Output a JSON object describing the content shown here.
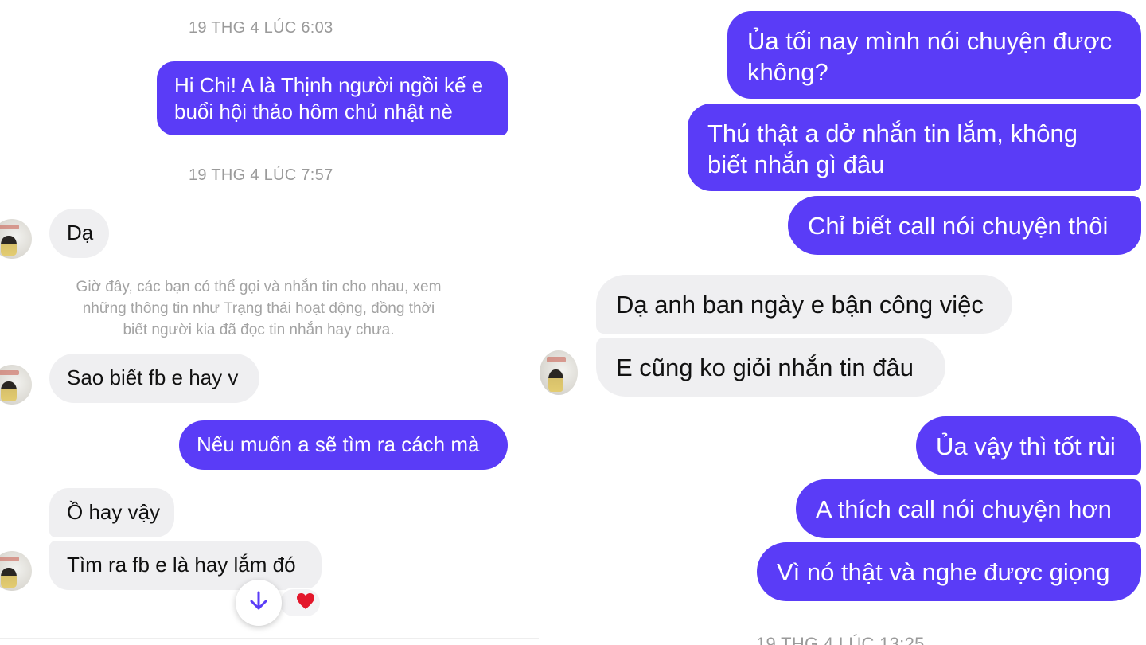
{
  "left": {
    "timestamp1": "19 THG 4 LÚC 6:03",
    "msg_out1_line1": "Hi Chi! A là Thịnh người ngồi kế e",
    "msg_out1_line2": "buổi hội thảo hôm chủ nhật nè",
    "timestamp2": "19 THG 4 LÚC 7:57",
    "msg_in1": "Dạ",
    "notice_line1": "Giờ đây, các bạn có thể gọi và nhắn tin cho nhau, xem",
    "notice_line2": "những thông tin như Trạng thái hoạt động, đồng thời",
    "notice_line3": "biết người kia đã đọc tin nhắn hay chưa.",
    "msg_in2": "Sao biết fb e hay v",
    "msg_out2": "Nếu muốn a sẽ tìm ra cách mà",
    "msg_in3": "Ồ hay vậy",
    "msg_in4": "Tìm ra fb e là hay lắm đó",
    "reaction_icon": "heart-icon",
    "scroll_icon": "arrow-down-icon"
  },
  "right": {
    "msg_out1_line1": "Ủa tối nay mình nói chuyện được",
    "msg_out1_line2": "không?",
    "msg_out2_line1": "Thú thật a dở nhắn tin lắm, không",
    "msg_out2_line2": "biết nhắn gì đâu",
    "msg_out3": "Chỉ biết call nói chuyện thôi",
    "msg_in1": "Dạ anh ban ngày e bận công việc",
    "msg_in2": "E cũng ko giỏi nhắn tin đâu",
    "msg_out4": "Ủa vậy thì tốt rùi",
    "msg_out5": "A thích call nói chuyện hơn",
    "msg_out6": "Vì nó thật và nghe được giọng",
    "timestamp_partial": "19 THG 4 LÚC 13:25"
  },
  "colors": {
    "outgoing_bubble": "#5a3cf7",
    "incoming_bubble": "#efeff1",
    "timestamp_text": "#9a9a9a"
  }
}
